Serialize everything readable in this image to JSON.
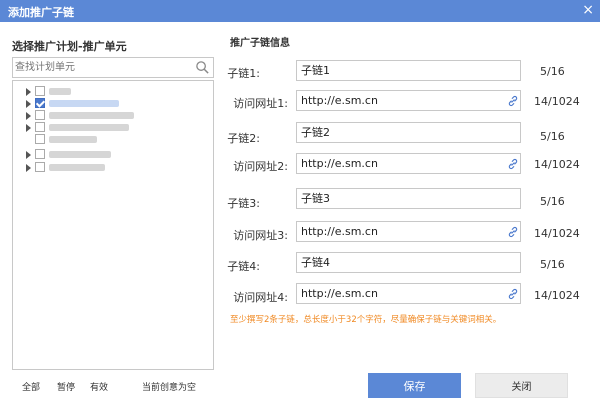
{
  "window": {
    "title": "添加推广子链",
    "close_glyph": "×"
  },
  "left_panel": {
    "title": "选择推广计划-推广单元",
    "search_placeholder": "查找计划单元",
    "tree": [
      {
        "expandable": true,
        "checked": false,
        "highlighted": false
      },
      {
        "expandable": true,
        "checked": true,
        "highlighted": true
      },
      {
        "expandable": true,
        "checked": false,
        "highlighted": false
      },
      {
        "expandable": true,
        "checked": false,
        "highlighted": false
      },
      {
        "expandable": false,
        "checked": false,
        "highlighted": false
      },
      {
        "expandable": true,
        "checked": false,
        "highlighted": false
      },
      {
        "expandable": true,
        "checked": false,
        "highlighted": false
      }
    ],
    "footer": {
      "all": "全部",
      "paused": "暂停",
      "valid": "有效",
      "current_empty": "当前创意为空"
    }
  },
  "right_panel": {
    "section_title": "推广子链信息",
    "fields": [
      {
        "label": "子链1:",
        "value": "子链1",
        "counter": "5/16",
        "type": "text"
      },
      {
        "label": "访问网址1:",
        "value": "http://e.sm.cn",
        "counter": "14/1024",
        "type": "url"
      },
      {
        "label": "子链2:",
        "value": "子链2",
        "counter": "5/16",
        "type": "text"
      },
      {
        "label": "访问网址2:",
        "value": "http://e.sm.cn",
        "counter": "14/1024",
        "type": "url"
      },
      {
        "label": "子链3:",
        "value": "子链3",
        "counter": "5/16",
        "type": "text"
      },
      {
        "label": "访问网址3:",
        "value": "http://e.sm.cn",
        "counter": "14/1024",
        "type": "url"
      },
      {
        "label": "子链4:",
        "value": "子链4",
        "counter": "5/16",
        "type": "text"
      },
      {
        "label": "访问网址4:",
        "value": "http://e.sm.cn",
        "counter": "14/1024",
        "type": "url"
      }
    ],
    "hint": "至少撰写2条子链，总长度小于32个字符，尽量确保子链与关键词相关。"
  },
  "buttons": {
    "save": "保存",
    "close": "关闭"
  },
  "colors": {
    "accent": "#5b88d6",
    "hint": "#f08a24",
    "link_icon": "#4a78cc"
  }
}
